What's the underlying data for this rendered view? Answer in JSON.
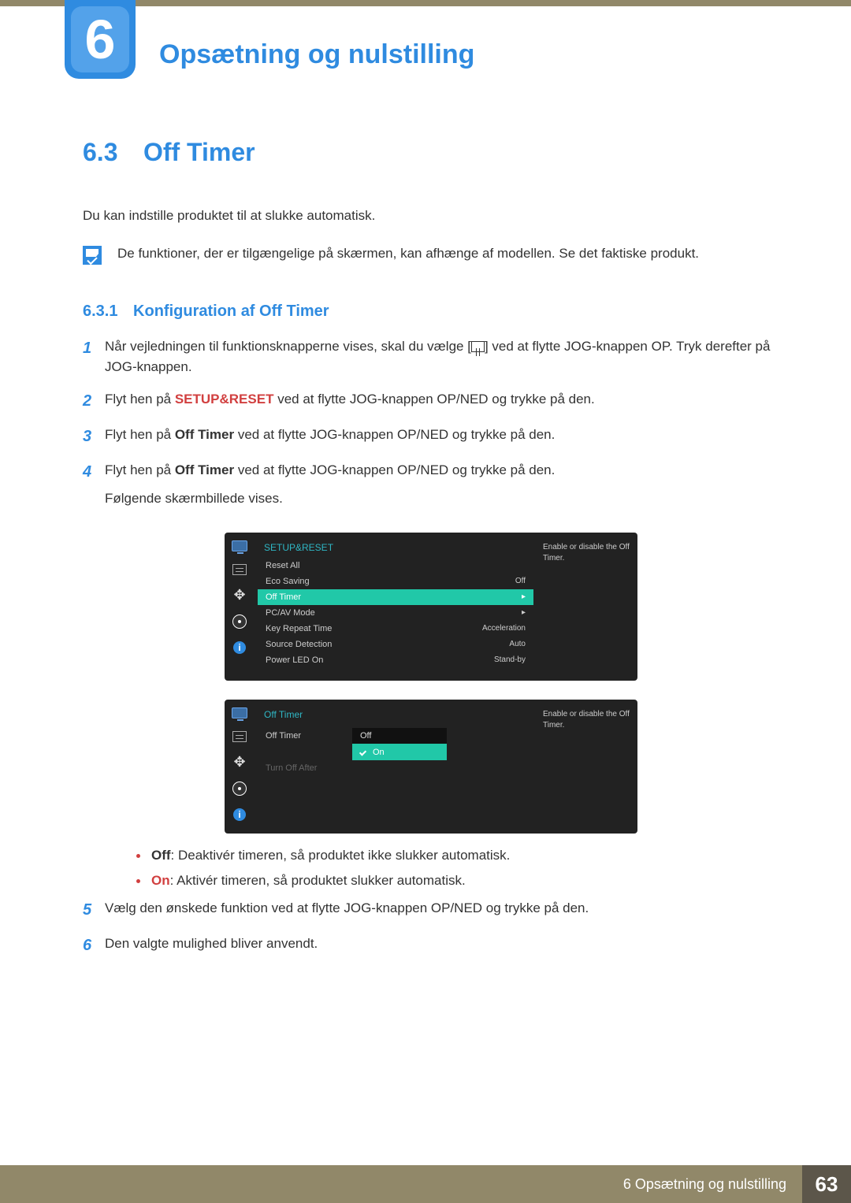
{
  "header": {
    "chapter_number": "6",
    "chapter_title": "Opsætning og nulstilling"
  },
  "section": {
    "number": "6.3",
    "title": "Off Timer"
  },
  "intro": "Du kan indstille produktet til at slukke automatisk.",
  "info_note": "De funktioner, der er tilgængelige på skærmen, kan afhænge af modellen. Se det faktiske produkt.",
  "subsection": {
    "number": "6.3.1",
    "title": "Konfiguration af Off Timer"
  },
  "steps": {
    "s1": {
      "n": "1",
      "a": "Når vejledningen til funktionsknapperne vises, skal du vælge [",
      "b": "] ved at flytte JOG-knappen OP. Tryk derefter på JOG-knappen."
    },
    "s2": {
      "n": "2",
      "a": "Flyt hen på ",
      "b": "SETUP&RESET",
      "c": " ved at flytte JOG-knappen OP/NED og trykke på den."
    },
    "s3": {
      "n": "3",
      "a": "Flyt hen på ",
      "b": "Off Timer",
      "c": " ved at flytte JOG-knappen OP/NED og trykke på den."
    },
    "s4": {
      "n": "4",
      "a": "Flyt hen på ",
      "b": "Off Timer",
      "c": " ved at flytte JOG-knappen OP/NED og trykke på den.",
      "d": "Følgende skærmbillede vises."
    },
    "s5": {
      "n": "5",
      "a": "Vælg den ønskede funktion ved at flytte JOG-knappen OP/NED og trykke på den."
    },
    "s6": {
      "n": "6",
      "a": "Den valgte mulighed bliver anvendt."
    }
  },
  "bullets": {
    "off_label": "Off",
    "off_text": ": Deaktivér timeren, så produktet ikke slukker automatisk.",
    "on_label": "On",
    "on_text": ": Aktivér timeren, så produktet slukker automatisk."
  },
  "osd1": {
    "title": "SETUP&RESET",
    "desc": "Enable or disable the Off Timer.",
    "rows": [
      {
        "label": "Reset All",
        "value": ""
      },
      {
        "label": "Eco Saving",
        "value": "Off"
      },
      {
        "label": "Off Timer",
        "value": "▸",
        "selected": true
      },
      {
        "label": "PC/AV Mode",
        "value": "▸"
      },
      {
        "label": "Key Repeat Time",
        "value": "Acceleration"
      },
      {
        "label": "Source Detection",
        "value": "Auto"
      },
      {
        "label": "Power LED On",
        "value": "Stand-by"
      }
    ]
  },
  "osd2": {
    "title": "Off Timer",
    "desc": "Enable or disable the Off Timer.",
    "option_label": "Off Timer",
    "option_dim": "Turn Off After",
    "opts": [
      {
        "label": "Off",
        "selected": false
      },
      {
        "label": "On",
        "selected": true
      }
    ]
  },
  "footer": {
    "text": "6 Opsætning og nulstilling",
    "page": "63"
  }
}
